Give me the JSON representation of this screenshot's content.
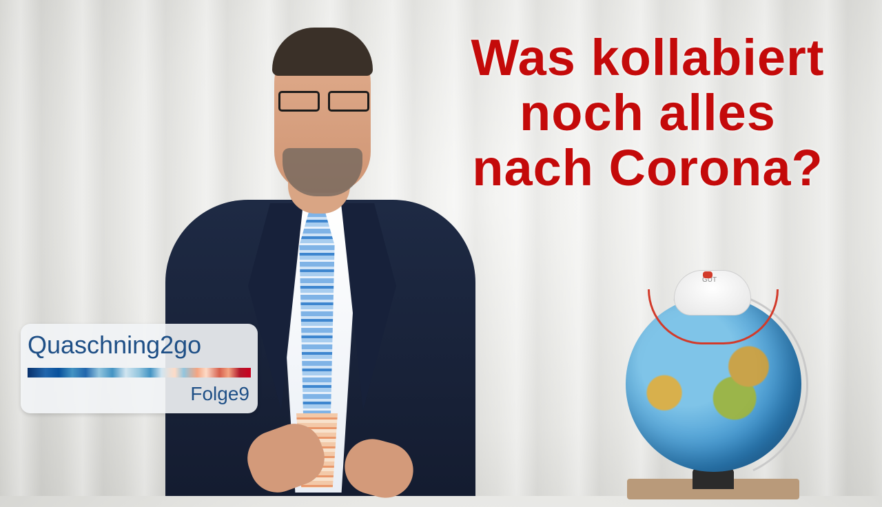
{
  "headline": {
    "line1": "Was kollabiert",
    "line2": "noch alles",
    "line3": "nach Corona?",
    "color": "#c40a0a"
  },
  "logo": {
    "title": "Quaschning2go",
    "episode": "Folge9",
    "title_color": "#1e4f86"
  },
  "mask_label": "GUT"
}
